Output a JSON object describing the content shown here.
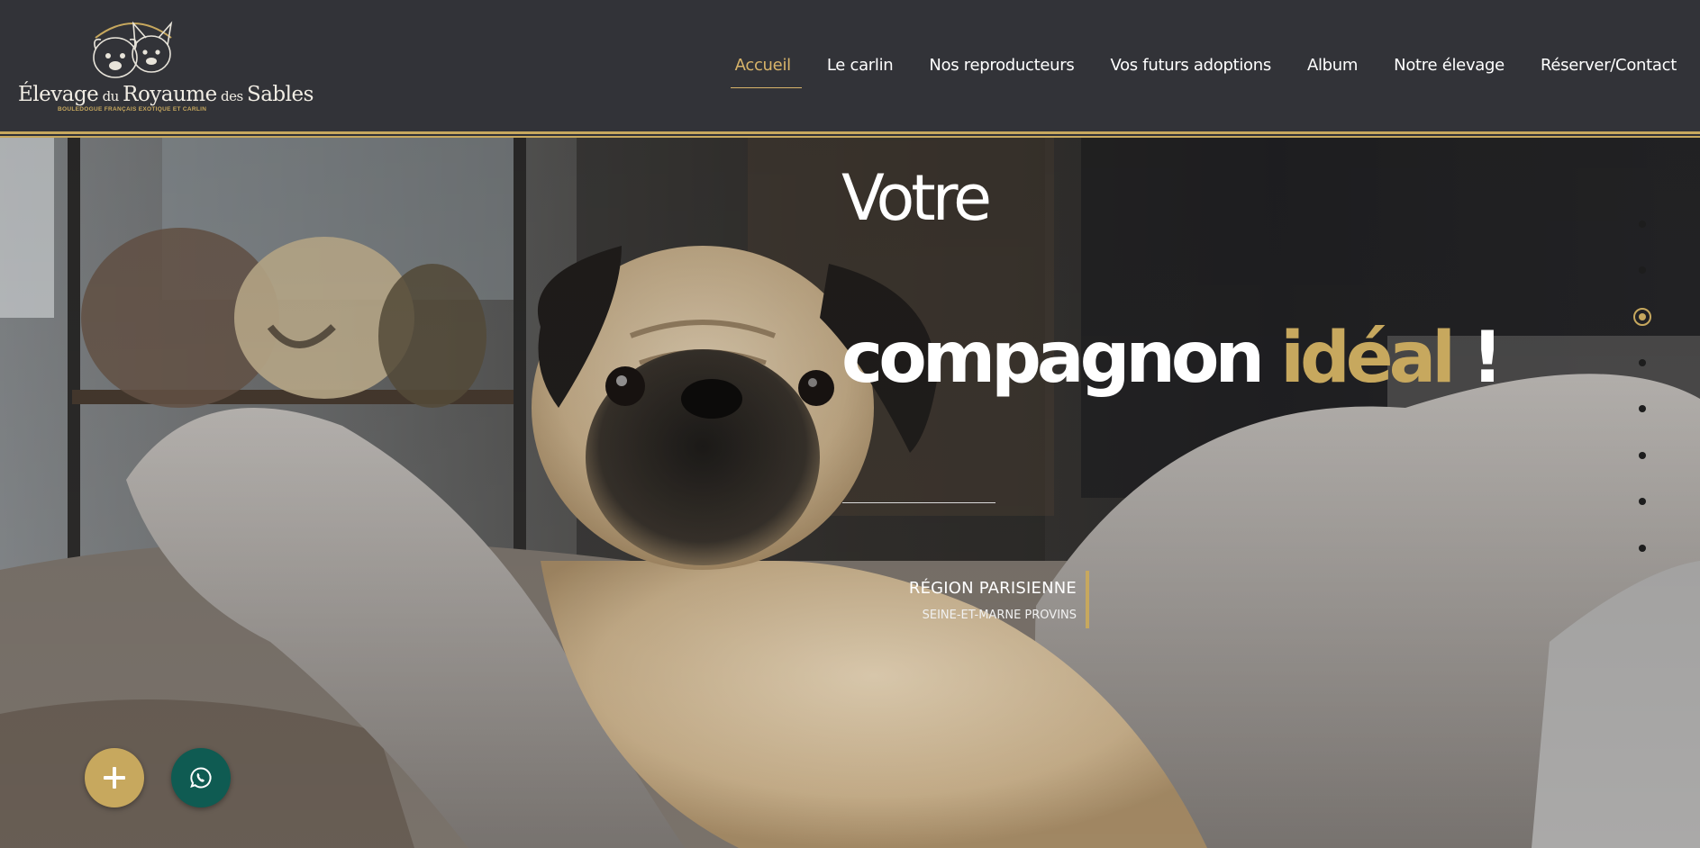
{
  "header": {
    "logo": {
      "title_part1": "Élevage",
      "title_small1": " du ",
      "title_part2": "Royaume",
      "title_small2": " des ",
      "title_part3": "Sables",
      "subtitle": "BOULEDOGUE FRANÇAIS EXOTIQUE ET CARLIN"
    },
    "nav": [
      {
        "label": "Accueil",
        "active": true
      },
      {
        "label": "Le carlin"
      },
      {
        "label": "Nos reproducteurs"
      },
      {
        "label": "Vos futurs adoptions"
      },
      {
        "label": "Album"
      },
      {
        "label": "Notre élevage"
      },
      {
        "label": "Réserver/Contact"
      }
    ]
  },
  "hero": {
    "title_line1": "Votre",
    "title_line2_white": "compagnon ",
    "title_line2_accent": "idéal",
    "title_line2_end": " !",
    "region_title": "RÉGION PARISIENNE",
    "region_subtitle": "SEINE-ET-MARNE PROVINS",
    "slide_dots": 8,
    "active_slide": 3
  },
  "floating_buttons": {
    "plus_icon": "plus-icon",
    "whatsapp_icon": "whatsapp-icon"
  },
  "colors": {
    "header_bg": "#323338",
    "accent_gold": "#c7a85e",
    "nav_active": "#d8b46a",
    "whatsapp_bg": "#0f5b52"
  }
}
